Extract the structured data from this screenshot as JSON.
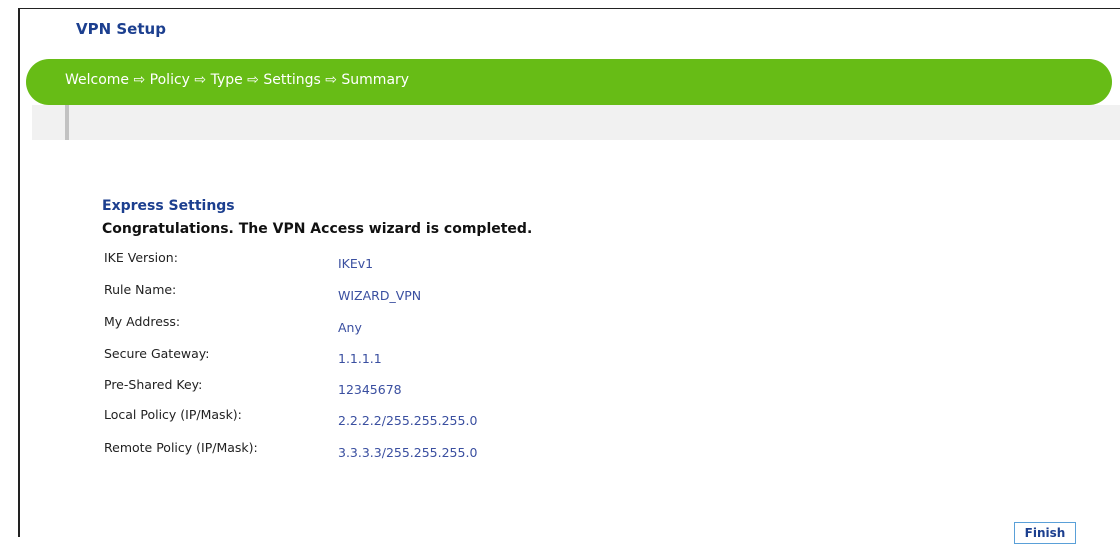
{
  "window": {
    "title": "VPN Setup"
  },
  "wizard": {
    "steps_text": "Welcome ⇨ Policy ⇨ Type ⇨ Settings ⇨ Summary"
  },
  "summary": {
    "section_title": "Express Settings",
    "message": "Congratulations. The VPN Access wizard is completed.",
    "rows": [
      {
        "label": "IKE Version:",
        "value": "IKEv1"
      },
      {
        "label": "Rule Name:",
        "value": "WIZARD_VPN"
      },
      {
        "label": "My Address:",
        "value": "Any"
      },
      {
        "label": "Secure Gateway:",
        "value": "1.1.1.1"
      },
      {
        "label": "Pre-Shared Key:",
        "value": "12345678"
      },
      {
        "label": "Local Policy (IP/Mask):",
        "value": "2.2.2.2/255.255.255.0"
      },
      {
        "label": "Remote Policy (IP/Mask):",
        "value": "3.3.3.3/255.255.255.0"
      }
    ]
  },
  "buttons": {
    "finish_label": "Finish"
  }
}
